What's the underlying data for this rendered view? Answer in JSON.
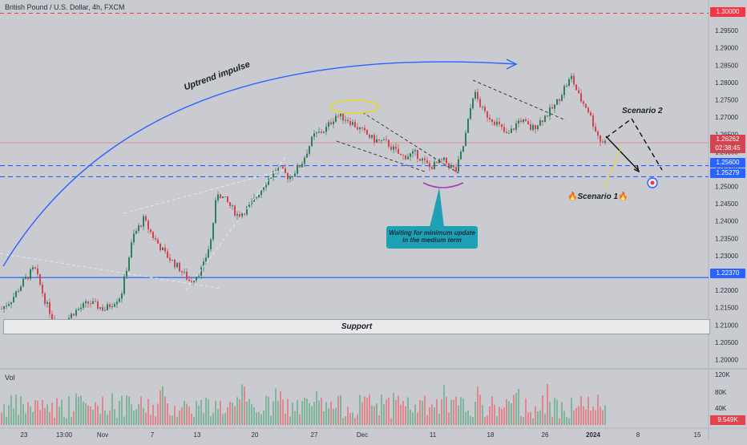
{
  "title": "British Pound / U.S. Dollar, 4h, FXCM",
  "vol_label": "Vol",
  "colors": {
    "background": "#c9cbd0",
    "bull": "#2e7d5b",
    "bear": "#d0454f",
    "blue_line": "#2962ff",
    "red_dash": "#f23645"
  },
  "annotations": {
    "uptrend": "Uptrend impulse",
    "scenario2": "Scenario 2",
    "scenario1": "Scenario 1",
    "callout": "Waiting for minimum update in the medium term",
    "support": "Support"
  },
  "price_badges": {
    "top_red": "1.30000",
    "current": "1.26262",
    "countdown": "02:38:45",
    "level1": "1.25600",
    "level2": "1.25279",
    "level3": "1.22370"
  },
  "volume_badge": "9.549K",
  "chart_data": {
    "type": "candlestick",
    "title": "British Pound / U.S. Dollar, 4h, FXCM",
    "y_ticks": [
      "1.30000",
      "1.29500",
      "1.29000",
      "1.28500",
      "1.28000",
      "1.27500",
      "1.27000",
      "1.26500",
      "1.26000",
      "1.25500",
      "1.25000",
      "1.24500",
      "1.24000",
      "1.23500",
      "1.23000",
      "1.22500",
      "1.22000",
      "1.21500",
      "1.21000",
      "1.20500",
      "1.20000"
    ],
    "x_ticks": [
      "23",
      "13:00",
      "Nov",
      "7",
      "13",
      "20",
      "27",
      "Dec",
      "11",
      "18",
      "26",
      "2024",
      "8",
      "15"
    ],
    "volume_ticks": [
      "120K",
      "80K",
      "40K"
    ],
    "ylim": [
      1.1985,
      1.3015
    ],
    "levels": {
      "resistance_red": 1.3,
      "blue_upper": 1.256,
      "blue_lower": 1.25279,
      "blue_solid": 1.2237
    },
    "current_price": 1.26262,
    "support_zone": [
      1.2062,
      1.2098
    ],
    "price_path": [
      [
        0,
        1.2145
      ],
      [
        14,
        1.2175
      ],
      [
        28,
        1.2225
      ],
      [
        42,
        1.2265
      ],
      [
        56,
        1.2165
      ],
      [
        72,
        1.2085
      ],
      [
        90,
        1.2135
      ],
      [
        110,
        1.2165
      ],
      [
        130,
        1.2145
      ],
      [
        150,
        1.2185
      ],
      [
        165,
        1.2355
      ],
      [
        178,
        1.2405
      ],
      [
        190,
        1.2355
      ],
      [
        205,
        1.2305
      ],
      [
        222,
        1.2265
      ],
      [
        236,
        1.2225
      ],
      [
        252,
        1.2265
      ],
      [
        262,
        1.2345
      ],
      [
        270,
        1.2485
      ],
      [
        282,
        1.2455
      ],
      [
        296,
        1.2415
      ],
      [
        312,
        1.2445
      ],
      [
        328,
        1.2505
      ],
      [
        345,
        1.2555
      ],
      [
        360,
        1.2525
      ],
      [
        375,
        1.2565
      ],
      [
        390,
        1.2645
      ],
      [
        405,
        1.2665
      ],
      [
        418,
        1.2705
      ],
      [
        432,
        1.2695
      ],
      [
        448,
        1.2665
      ],
      [
        465,
        1.2635
      ],
      [
        482,
        1.2625
      ],
      [
        500,
        1.2585
      ],
      [
        518,
        1.2595
      ],
      [
        535,
        1.2555
      ],
      [
        552,
        1.2575
      ],
      [
        568,
        1.2545
      ],
      [
        578,
        1.2625
      ],
      [
        590,
        1.2775
      ],
      [
        602,
        1.2715
      ],
      [
        618,
        1.2685
      ],
      [
        632,
        1.2645
      ],
      [
        648,
        1.2695
      ],
      [
        662,
        1.2665
      ],
      [
        676,
        1.2695
      ],
      [
        692,
        1.2735
      ],
      [
        703,
        1.2785
      ],
      [
        712,
        1.2815
      ],
      [
        722,
        1.2755
      ],
      [
        732,
        1.2725
      ],
      [
        740,
        1.2675
      ],
      [
        748,
        1.2632
      ],
      [
        754,
        1.2628
      ]
    ]
  }
}
